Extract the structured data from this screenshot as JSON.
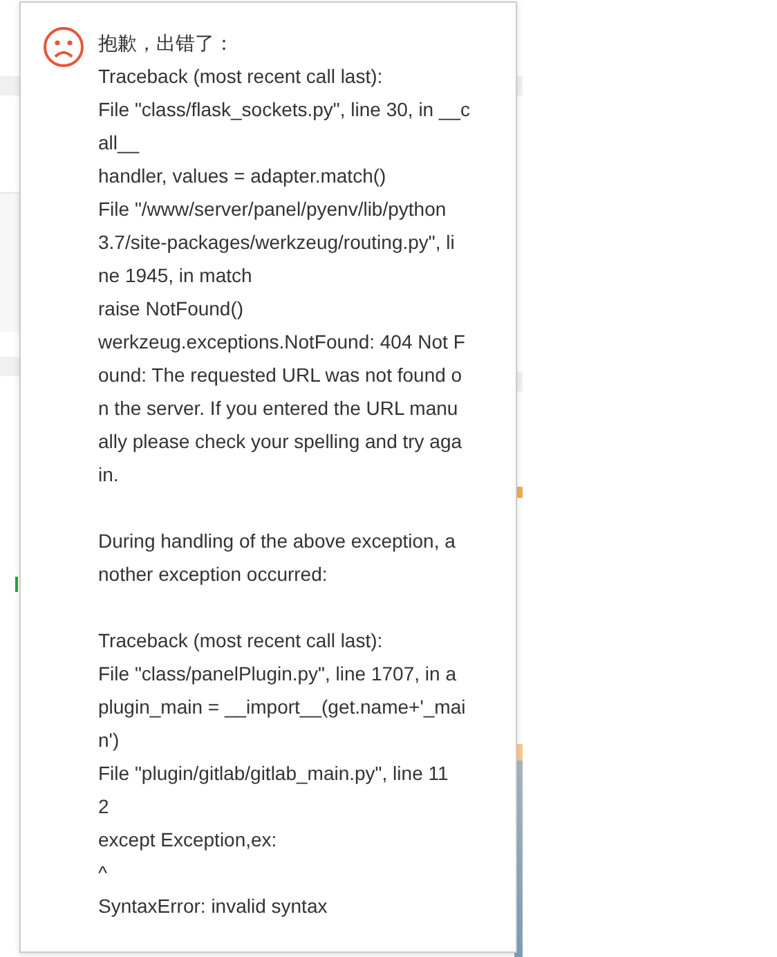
{
  "error_dialog": {
    "title": "抱歉，出错了：",
    "paragraphs": [
      [
        "Traceback (most recent call last):",
        "File \"class/flask_sockets.py\", line 30, in __c",
        "all__",
        "handler, values = adapter.match()",
        "File \"/www/server/panel/pyenv/lib/python",
        "3.7/site-packages/werkzeug/routing.py\", li",
        "ne 1945, in match",
        "raise NotFound()",
        "werkzeug.exceptions.NotFound: 404 Not F",
        "ound: The requested URL was not found o",
        "n the server. If you entered the URL manu",
        "ally please check your spelling and try aga",
        "in."
      ],
      [
        "During handling of the above exception, a",
        "nother exception occurred:"
      ],
      [
        "Traceback (most recent call last):",
        "File \"class/panelPlugin.py\", line 1707, in a",
        "plugin_main = __import__(get.name+'_mai",
        "n')",
        "File \"plugin/gitlab/gitlab_main.py\", line 11",
        "2",
        "except Exception,ex:",
        "^",
        "SyntaxError: invalid syntax"
      ]
    ]
  }
}
